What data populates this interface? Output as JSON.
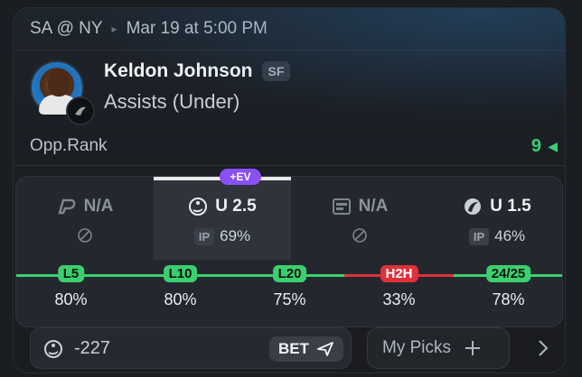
{
  "game": {
    "matchup": "SA @ NY",
    "datetime": "Mar 19 at 5:00 PM"
  },
  "player": {
    "name": "Keldon Johnson",
    "position": "SF",
    "market": "Assists (Under)"
  },
  "opponent": {
    "label": "Opp.Rank",
    "value": "9"
  },
  "ev_badge": "+EV",
  "books": [
    {
      "icon": "book-1-icon",
      "value": "N/A",
      "sub_type": "none"
    },
    {
      "icon": "book-2-icon",
      "value": "U 2.5",
      "ip_label": "IP",
      "ip_value": "69%",
      "active": true
    },
    {
      "icon": "book-3-icon",
      "value": "N/A",
      "sub_type": "none"
    },
    {
      "icon": "book-4-icon",
      "value": "U 1.5",
      "ip_label": "IP",
      "ip_value": "46%"
    }
  ],
  "history": [
    {
      "label": "L5",
      "value": "80%",
      "color": "#3bd06f"
    },
    {
      "label": "L10",
      "value": "80%",
      "color": "#3bd06f"
    },
    {
      "label": "L20",
      "value": "75%",
      "color": "#3bd06f"
    },
    {
      "label": "H2H",
      "value": "33%",
      "color": "#e0303a"
    },
    {
      "label": "24/25",
      "value": "78%",
      "color": "#3bd06f"
    }
  ],
  "bet": {
    "odds": "-227",
    "button_label": "BET"
  },
  "picks": {
    "label": "My Picks"
  },
  "colors": {
    "green": "#38d07a",
    "red": "#e0303a",
    "purple": "#8a4ff5"
  }
}
